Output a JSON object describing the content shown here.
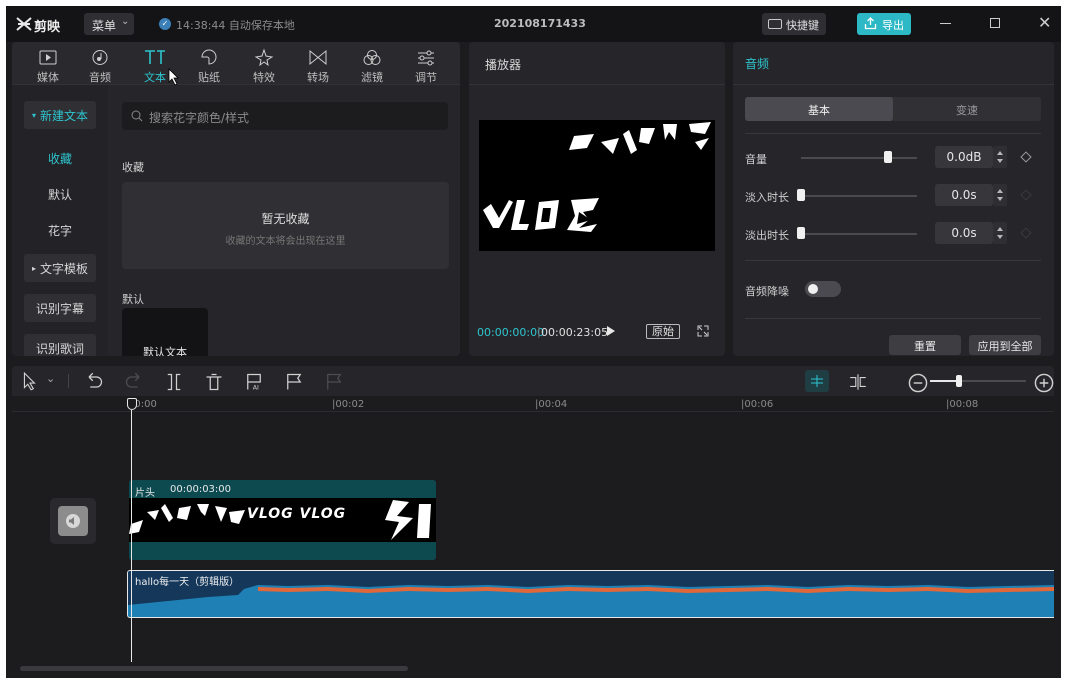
{
  "titlebar": {
    "app_name": "剪映",
    "menu_label": "菜单",
    "autosave_text": "14:38:44 自动保存本地",
    "project_name": "202108171433",
    "shortcut_label": "快捷键",
    "export_label": "导出"
  },
  "media_tabs": [
    {
      "label": "媒体",
      "icon": "media-icon"
    },
    {
      "label": "音频",
      "icon": "audio-icon"
    },
    {
      "label": "文本",
      "icon": "text-icon"
    },
    {
      "label": "贴纸",
      "icon": "sticker-icon"
    },
    {
      "label": "特效",
      "icon": "effects-icon"
    },
    {
      "label": "转场",
      "icon": "transition-icon"
    },
    {
      "label": "滤镜",
      "icon": "filter-icon"
    },
    {
      "label": "调节",
      "icon": "adjust-icon"
    }
  ],
  "text_sidebar": {
    "items": [
      "新建文本",
      "收藏",
      "默认",
      "花字",
      "文字模板",
      "识别字幕",
      "识别歌词"
    ]
  },
  "text_content": {
    "search_placeholder": "搜索花字颜色/样式",
    "favorites_heading": "收藏",
    "empty_title": "暂无收藏",
    "empty_subtitle": "收藏的文本将会出现在这里",
    "default_heading": "默认",
    "default_card_label": "默认文本"
  },
  "player": {
    "title": "播放器",
    "current_time": "00:00:00:00",
    "total_time": "00:00:23:05",
    "ratio_label": "原始",
    "preview_text": "VLOG"
  },
  "inspector": {
    "title": "音频",
    "tabs": [
      "基本",
      "变速"
    ],
    "volume_label": "音量",
    "volume_value": "0.0dB",
    "volume_level": 0.75,
    "fadein_label": "淡入时长",
    "fadein_value": "0.0s",
    "fadeout_label": "淡出时长",
    "fadeout_value": "0.0s",
    "denoise_label": "音频降噪",
    "denoise_on": false,
    "reset_label": "重置",
    "apply_all_label": "应用到全部"
  },
  "timeline": {
    "ruler": [
      "00:00",
      "00:02",
      "00:04",
      "00:06",
      "00:08"
    ],
    "text_clip_label": "片头",
    "text_clip_duration": "00:00:03:00",
    "text_clip_preview": "VLOG VLOG",
    "audio_clip_label": "hallo每一天（剪辑版）"
  },
  "colors": {
    "accent": "#2ec5cf",
    "text_track": "#0d4a50",
    "audio_track": "#1e80b5",
    "audio_peak": "#e0673a"
  }
}
